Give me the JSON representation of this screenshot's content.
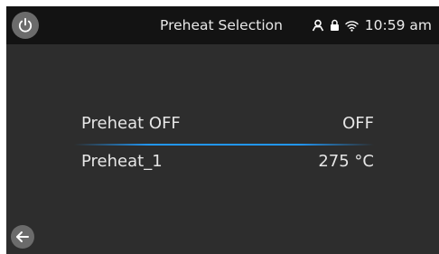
{
  "header": {
    "title": "Preheat Selection",
    "time": "10:59 am",
    "icons": [
      "power-icon",
      "user-icon",
      "lock-icon",
      "wifi-icon"
    ]
  },
  "preheat_options": [
    {
      "label": "Preheat OFF",
      "value": "OFF"
    },
    {
      "label": "Preheat_1",
      "value": "275 °C"
    }
  ],
  "footer": {
    "icons": [
      "back-arrow-icon"
    ]
  },
  "colors": {
    "background": "#2d2d2d",
    "topbar": "#131313",
    "accent": "#2196f3",
    "button": "#6b6b6b",
    "text": "#e6e6e6"
  }
}
